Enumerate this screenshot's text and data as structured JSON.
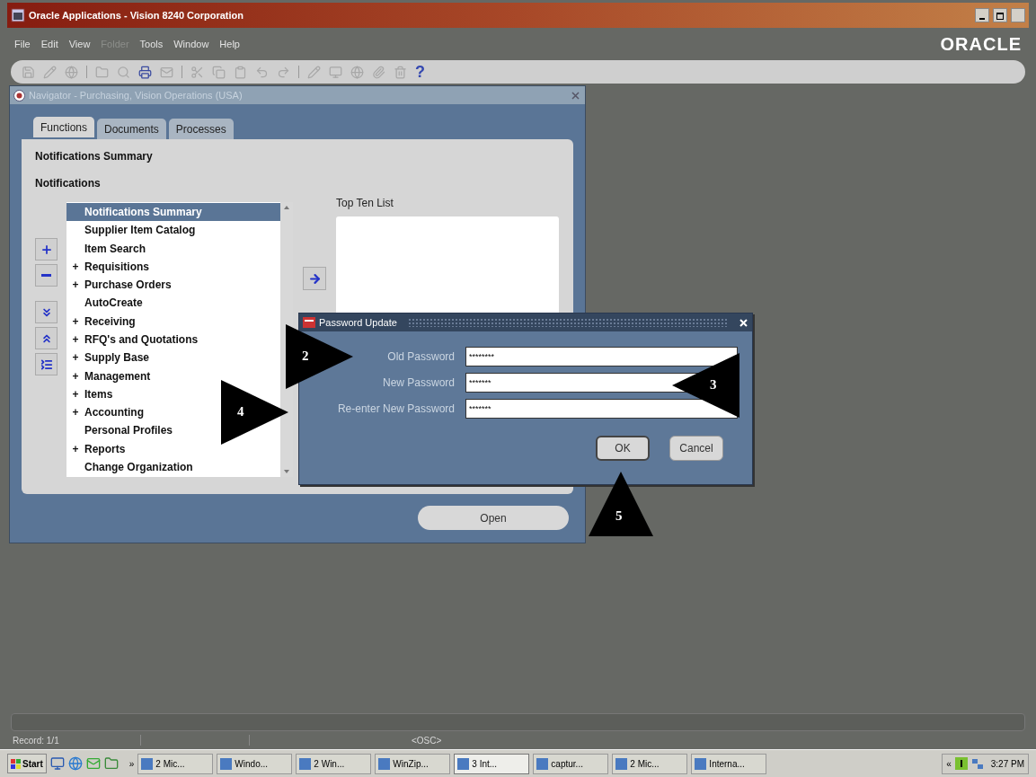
{
  "window": {
    "title": "Oracle Applications - Vision 8240 Corporation"
  },
  "menu": [
    {
      "label": "File",
      "disabled": false
    },
    {
      "label": "Edit",
      "disabled": false
    },
    {
      "label": "View",
      "disabled": false
    },
    {
      "label": "Folder",
      "disabled": true
    },
    {
      "label": "Tools",
      "disabled": false
    },
    {
      "label": "Window",
      "disabled": false
    },
    {
      "label": "Help",
      "disabled": false
    }
  ],
  "brand": "ORACLE",
  "toolbar": {
    "help": "?"
  },
  "navigator": {
    "title": "Navigator - Purchasing, Vision Operations (USA)",
    "tabs": [
      {
        "label": "Functions",
        "selected": true
      },
      {
        "label": "Documents",
        "selected": false
      },
      {
        "label": "Processes",
        "selected": false
      }
    ],
    "heading": "Notifications Summary",
    "subheading": "Notifications",
    "list": [
      {
        "label": "Notifications Summary",
        "selected": true
      },
      {
        "label": "Supplier Item Catalog",
        "selected": false
      },
      {
        "label": "Item Search",
        "selected": false
      },
      {
        "label": "Requisitions",
        "prefix": "+",
        "selected": false
      },
      {
        "label": "Purchase Orders",
        "prefix": "+",
        "selected": false
      },
      {
        "label": "AutoCreate",
        "selected": false
      },
      {
        "label": "Receiving",
        "prefix": "+",
        "selected": false
      },
      {
        "label": "RFQ's and Quotations",
        "prefix": "+",
        "selected": false
      },
      {
        "label": "Supply Base",
        "prefix": "+",
        "selected": false
      },
      {
        "label": "Management",
        "prefix": "+",
        "selected": false
      },
      {
        "label": "Items",
        "prefix": "+",
        "selected": false
      },
      {
        "label": "Accounting",
        "prefix": "+",
        "selected": false
      },
      {
        "label": "Personal Profiles",
        "selected": false
      },
      {
        "label": "Reports",
        "prefix": "+",
        "selected": false
      },
      {
        "label": "Change Organization",
        "selected": false
      }
    ],
    "top_ten_label": "Top Ten List",
    "open_button": "Open"
  },
  "dialog": {
    "title": "Password Update",
    "fields": [
      {
        "label": "Old Password",
        "value": "********"
      },
      {
        "label": "New Password",
        "value": "*******"
      },
      {
        "label": "Re-enter New Password",
        "value": "*******"
      }
    ],
    "buttons": [
      {
        "label": "OK",
        "kind": "default"
      },
      {
        "label": "Cancel",
        "kind": "normal"
      }
    ]
  },
  "callouts": [
    {
      "number": "2",
      "kind": "right"
    },
    {
      "number": "3",
      "kind": "left"
    },
    {
      "number": "4",
      "kind": "right"
    },
    {
      "number": "5",
      "kind": "up"
    }
  ],
  "status_bar": {
    "record": "Record: 1/1",
    "mode": "<OSC>"
  },
  "taskbar": {
    "start": "Start",
    "more": "»",
    "items": [
      {
        "label": "2 Mic...",
        "selected": false
      },
      {
        "label": "Windo...",
        "selected": false
      },
      {
        "label": "2 Win...",
        "selected": false
      },
      {
        "label": "WinZip...",
        "selected": false
      },
      {
        "label": "3 Int...",
        "selected": true
      },
      {
        "label": "captur...",
        "selected": false
      },
      {
        "label": "2 Mic...",
        "selected": false
      },
      {
        "label": "Interna...",
        "selected": false
      }
    ],
    "tray_more": "«",
    "clock": "3:27 PM"
  }
}
